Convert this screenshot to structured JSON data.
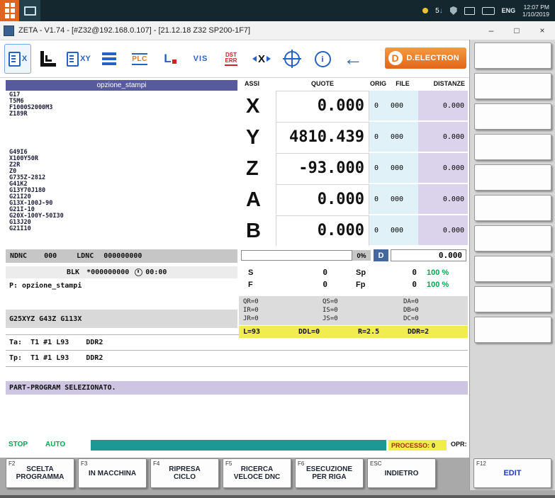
{
  "colors": {
    "accent_orange": "#e8761f",
    "header_purple": "#575b9e",
    "message_purple": "#cdc5e2",
    "orig_column_blue": "#e0f1f8",
    "distance_column_purple": "#dbd3eb",
    "highlight_yellow": "#f1ed4f",
    "status_teal": "#1d9894",
    "ok_green": "#00a651",
    "icon_blue": "#2463c4",
    "error_red": "#cc2222"
  },
  "os_bar": {
    "time": "12:07 PM",
    "date": "1/10/2019",
    "lang": "ENG",
    "download_count": "5"
  },
  "title_bar": {
    "title": "ZETA - V1.74 - [#Z32@192.168.0.107] - [21.12.18 Z32 SP200-1F7]",
    "minimize": "–",
    "maximize": "□",
    "close": "×"
  },
  "toolbar": {
    "logo_d": "D",
    "logo_text": "D.ELECTRON",
    "icons": [
      {
        "name": "part-program-icon",
        "text": "X"
      },
      {
        "name": "blocks-icon",
        "text": ""
      },
      {
        "name": "axes-program-icon",
        "text": "XY"
      },
      {
        "name": "list-icon",
        "text": ""
      },
      {
        "name": "plc-icon",
        "text": "PLC"
      },
      {
        "name": "logic-l-icon",
        "text": "L"
      },
      {
        "name": "vis-icon",
        "text": "VIS"
      },
      {
        "name": "dst-err-icon",
        "text": "DST",
        "text2": "ERR"
      },
      {
        "name": "delete-block-icon",
        "text": "X"
      },
      {
        "name": "target-icon",
        "text": ""
      },
      {
        "name": "info-icon",
        "text": "i"
      },
      {
        "name": "back-arrow-icon",
        "text": "←"
      }
    ]
  },
  "program_panel": {
    "header": "opzione_stampi",
    "lines": [
      "G17",
      "T5M6",
      "F1000S2000M3",
      "Z189R",
      "",
      "",
      "",
      "",
      "",
      "G49I6",
      "X100Y50R",
      "Z2R",
      "Z0",
      "G735Z-2812",
      "G41K2",
      "G13Y70J180",
      "G21I20",
      "G13X-100J-90",
      "G21I-10",
      "G20X-100Y-50I30",
      "G13J20",
      "G21I10"
    ],
    "ndnc_label": "NDNC",
    "ndnc_value": "000",
    "ldnc_label": "LDNC",
    "ldnc_value": "000000000",
    "blk_label": "BLK",
    "blk_value": "*000000000",
    "blk_time": "00:00",
    "p_line": "P: opzione_stampi",
    "g_functions": "G25XYZ G43Z G113X",
    "ta_line": "Ta:  T1 #1 L93    DDR2",
    "tp_line": "Tp:  T1 #1 L93    DDR2",
    "message": "PART-PROGRAM SELEZIONATO."
  },
  "axes": {
    "headers": [
      "ASSI",
      "QUOTE",
      "ORIG",
      "FILE",
      "DISTANZE"
    ],
    "rows": [
      {
        "name": "X",
        "quote": "0.000",
        "orig": "0",
        "file": "000",
        "dist": "0.000"
      },
      {
        "name": "Y",
        "quote": "4810.439",
        "orig": "0",
        "file": "000",
        "dist": "0.000"
      },
      {
        "name": "Z",
        "quote": "-93.000",
        "orig": "0",
        "file": "000",
        "dist": "0.000"
      },
      {
        "name": "A",
        "quote": "0.000",
        "orig": "0",
        "file": "000",
        "dist": "0.000"
      },
      {
        "name": "B",
        "quote": "0.000",
        "orig": "0",
        "file": "000",
        "dist": "0.000"
      }
    ],
    "override": {
      "percent": "0%",
      "d_label": "D",
      "d_value": "0.000"
    },
    "feeds": [
      {
        "l1": "S",
        "v1": "0",
        "l2": "Sp",
        "v2": "0",
        "pct": "100 %"
      },
      {
        "l1": "F",
        "v1": "0",
        "l2": "Fp",
        "v2": "0",
        "pct": "100 %"
      }
    ],
    "qij": [
      [
        "QR=0",
        "QS=0",
        "DA=0"
      ],
      [
        "IR=0",
        "IS=0",
        "DB=0"
      ],
      [
        "JR=0",
        "JS=0",
        "DC=0"
      ]
    ],
    "tool_row": [
      "L=93",
      "DDL=0",
      "R=2.5",
      "DDR=2"
    ]
  },
  "status_bar": {
    "stop": "STOP",
    "mode": "AUTO",
    "processo_label": "PROCESSO:",
    "processo_value": "0",
    "opr_label": "OPR:"
  },
  "function_keys": [
    {
      "key": "F2",
      "label": "SCELTA\nPROGRAMMA"
    },
    {
      "key": "F3",
      "label": "IN MACCHINA"
    },
    {
      "key": "F4",
      "label": "RIPRESA\nCICLO"
    },
    {
      "key": "F5",
      "label": "RICERCA\nVELOCE DNC"
    },
    {
      "key": "F6",
      "label": "ESECUZIONE\nPER RIGA"
    },
    {
      "key": "ESC",
      "label": "INDIETRO"
    },
    {
      "key": "F12",
      "label": "EDIT"
    }
  ]
}
